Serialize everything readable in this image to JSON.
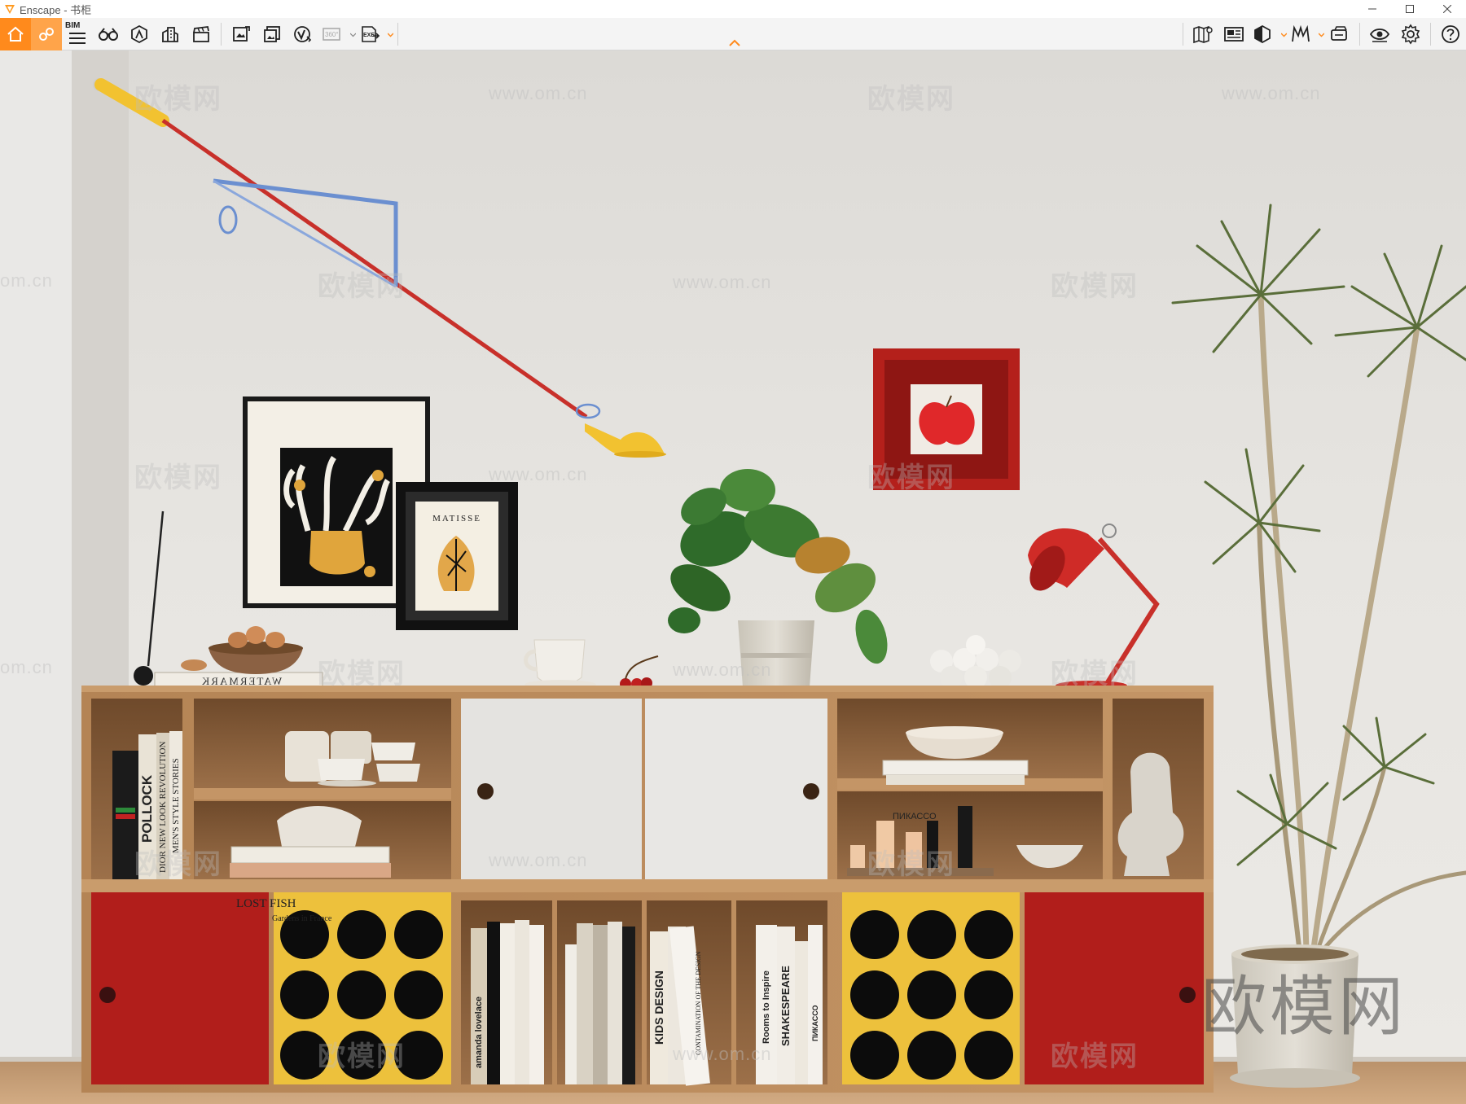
{
  "window": {
    "title": "Enscape - 书柜",
    "controls": [
      "minimize",
      "maximize",
      "close"
    ]
  },
  "toolbar": {
    "left_buttons": [
      {
        "name": "home-button",
        "icon": "home-icon"
      },
      {
        "name": "link-button",
        "icon": "link-icon"
      },
      {
        "name": "bim-button",
        "icon": "bim-icon",
        "label": "BIM"
      },
      {
        "name": "walk-mode-button",
        "icon": "binoculars-icon"
      },
      {
        "name": "asset-library-button",
        "icon": "asset-icon"
      },
      {
        "name": "building-button",
        "icon": "building-icon"
      },
      {
        "name": "video-editor-button",
        "icon": "clapperboard-icon"
      },
      {
        "name": "screenshot-button",
        "icon": "image-export-icon"
      },
      {
        "name": "batch-render-button",
        "icon": "batch-export-icon"
      },
      {
        "name": "vr-button",
        "icon": "vr-icon"
      },
      {
        "name": "panorama-button",
        "icon": "panorama-360-icon",
        "label": "360°"
      },
      {
        "name": "exe-export-button",
        "icon": "exe-export-icon",
        "label": "EXE"
      }
    ],
    "right_buttons": [
      {
        "name": "map-button",
        "icon": "map-icon"
      },
      {
        "name": "views-button",
        "icon": "views-icon"
      },
      {
        "name": "section-button",
        "icon": "section-icon"
      },
      {
        "name": "materials-button",
        "icon": "materials-icon"
      },
      {
        "name": "capture-button",
        "icon": "capture-icon"
      },
      {
        "name": "visibility-button",
        "icon": "eye-icon"
      },
      {
        "name": "settings-button",
        "icon": "gear-icon"
      },
      {
        "name": "help-button",
        "icon": "help-icon"
      }
    ],
    "accent": "#ff8a1c"
  },
  "render": {
    "watermark": "欧模网",
    "watermark_url": "www.om.cn",
    "watermark_cn": "om.cn",
    "books_left": [
      "POLLOCK",
      "DIOR NEW LOOK REVOLUTION",
      "MEN'S STYLE STORIES"
    ],
    "book_flat_top": "WATERMARK",
    "book_lost_fish": "LOST FISH",
    "book_gardens": "Gardens in France",
    "book_picasso": "ПИКАССО",
    "book_kids_design": "KIDS DESIGN",
    "book_contamination": "CONTAMINATION OF THE DESIGN",
    "book_rooms": "Rooms to Inspire",
    "book_shakespeare": "SHAKESPEARE",
    "book_amanda": "amanda lovelace",
    "poster_title": "MATISSE"
  }
}
